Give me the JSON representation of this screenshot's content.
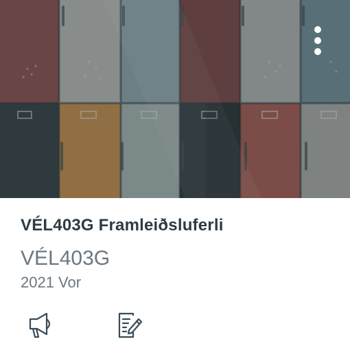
{
  "course": {
    "title": "VÉL403G Framleiðsluferli",
    "code": "VÉL403G",
    "term": "2021 Vor",
    "overlay_color": "#2d3b45"
  },
  "actions": [
    {
      "icon": "megaphone-icon",
      "name": "announcements"
    },
    {
      "icon": "assignment-edit-icon",
      "name": "assignments"
    }
  ],
  "menu": {
    "icon": "kebab-menu-icon"
  }
}
